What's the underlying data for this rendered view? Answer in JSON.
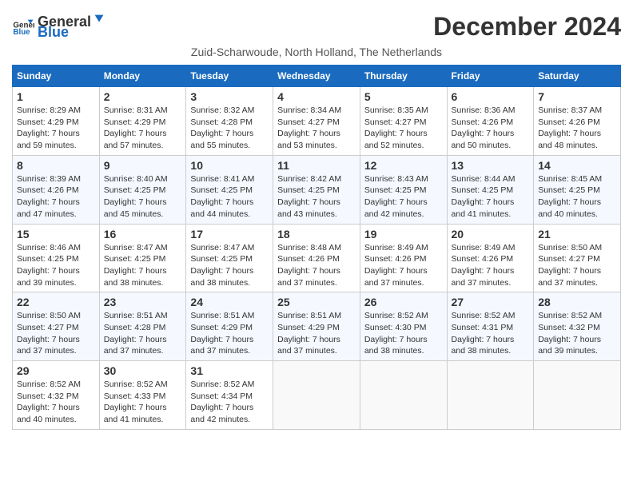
{
  "header": {
    "logo_general": "General",
    "logo_blue": "Blue",
    "main_title": "December 2024",
    "subtitle": "Zuid-Scharwoude, North Holland, The Netherlands"
  },
  "days_of_week": [
    "Sunday",
    "Monday",
    "Tuesday",
    "Wednesday",
    "Thursday",
    "Friday",
    "Saturday"
  ],
  "weeks": [
    [
      {
        "day": "1",
        "sunrise": "8:29 AM",
        "sunset": "4:29 PM",
        "daylight": "7 hours and 59 minutes."
      },
      {
        "day": "2",
        "sunrise": "8:31 AM",
        "sunset": "4:29 PM",
        "daylight": "7 hours and 57 minutes."
      },
      {
        "day": "3",
        "sunrise": "8:32 AM",
        "sunset": "4:28 PM",
        "daylight": "7 hours and 55 minutes."
      },
      {
        "day": "4",
        "sunrise": "8:34 AM",
        "sunset": "4:27 PM",
        "daylight": "7 hours and 53 minutes."
      },
      {
        "day": "5",
        "sunrise": "8:35 AM",
        "sunset": "4:27 PM",
        "daylight": "7 hours and 52 minutes."
      },
      {
        "day": "6",
        "sunrise": "8:36 AM",
        "sunset": "4:26 PM",
        "daylight": "7 hours and 50 minutes."
      },
      {
        "day": "7",
        "sunrise": "8:37 AM",
        "sunset": "4:26 PM",
        "daylight": "7 hours and 48 minutes."
      }
    ],
    [
      {
        "day": "8",
        "sunrise": "8:39 AM",
        "sunset": "4:26 PM",
        "daylight": "7 hours and 47 minutes."
      },
      {
        "day": "9",
        "sunrise": "8:40 AM",
        "sunset": "4:25 PM",
        "daylight": "7 hours and 45 minutes."
      },
      {
        "day": "10",
        "sunrise": "8:41 AM",
        "sunset": "4:25 PM",
        "daylight": "7 hours and 44 minutes."
      },
      {
        "day": "11",
        "sunrise": "8:42 AM",
        "sunset": "4:25 PM",
        "daylight": "7 hours and 43 minutes."
      },
      {
        "day": "12",
        "sunrise": "8:43 AM",
        "sunset": "4:25 PM",
        "daylight": "7 hours and 42 minutes."
      },
      {
        "day": "13",
        "sunrise": "8:44 AM",
        "sunset": "4:25 PM",
        "daylight": "7 hours and 41 minutes."
      },
      {
        "day": "14",
        "sunrise": "8:45 AM",
        "sunset": "4:25 PM",
        "daylight": "7 hours and 40 minutes."
      }
    ],
    [
      {
        "day": "15",
        "sunrise": "8:46 AM",
        "sunset": "4:25 PM",
        "daylight": "7 hours and 39 minutes."
      },
      {
        "day": "16",
        "sunrise": "8:47 AM",
        "sunset": "4:25 PM",
        "daylight": "7 hours and 38 minutes."
      },
      {
        "day": "17",
        "sunrise": "8:47 AM",
        "sunset": "4:25 PM",
        "daylight": "7 hours and 38 minutes."
      },
      {
        "day": "18",
        "sunrise": "8:48 AM",
        "sunset": "4:26 PM",
        "daylight": "7 hours and 37 minutes."
      },
      {
        "day": "19",
        "sunrise": "8:49 AM",
        "sunset": "4:26 PM",
        "daylight": "7 hours and 37 minutes."
      },
      {
        "day": "20",
        "sunrise": "8:49 AM",
        "sunset": "4:26 PM",
        "daylight": "7 hours and 37 minutes."
      },
      {
        "day": "21",
        "sunrise": "8:50 AM",
        "sunset": "4:27 PM",
        "daylight": "7 hours and 37 minutes."
      }
    ],
    [
      {
        "day": "22",
        "sunrise": "8:50 AM",
        "sunset": "4:27 PM",
        "daylight": "7 hours and 37 minutes."
      },
      {
        "day": "23",
        "sunrise": "8:51 AM",
        "sunset": "4:28 PM",
        "daylight": "7 hours and 37 minutes."
      },
      {
        "day": "24",
        "sunrise": "8:51 AM",
        "sunset": "4:29 PM",
        "daylight": "7 hours and 37 minutes."
      },
      {
        "day": "25",
        "sunrise": "8:51 AM",
        "sunset": "4:29 PM",
        "daylight": "7 hours and 37 minutes."
      },
      {
        "day": "26",
        "sunrise": "8:52 AM",
        "sunset": "4:30 PM",
        "daylight": "7 hours and 38 minutes."
      },
      {
        "day": "27",
        "sunrise": "8:52 AM",
        "sunset": "4:31 PM",
        "daylight": "7 hours and 38 minutes."
      },
      {
        "day": "28",
        "sunrise": "8:52 AM",
        "sunset": "4:32 PM",
        "daylight": "7 hours and 39 minutes."
      }
    ],
    [
      {
        "day": "29",
        "sunrise": "8:52 AM",
        "sunset": "4:32 PM",
        "daylight": "7 hours and 40 minutes."
      },
      {
        "day": "30",
        "sunrise": "8:52 AM",
        "sunset": "4:33 PM",
        "daylight": "7 hours and 41 minutes."
      },
      {
        "day": "31",
        "sunrise": "8:52 AM",
        "sunset": "4:34 PM",
        "daylight": "7 hours and 42 minutes."
      },
      null,
      null,
      null,
      null
    ]
  ],
  "labels": {
    "sunrise": "Sunrise:",
    "sunset": "Sunset:",
    "daylight": "Daylight:"
  }
}
